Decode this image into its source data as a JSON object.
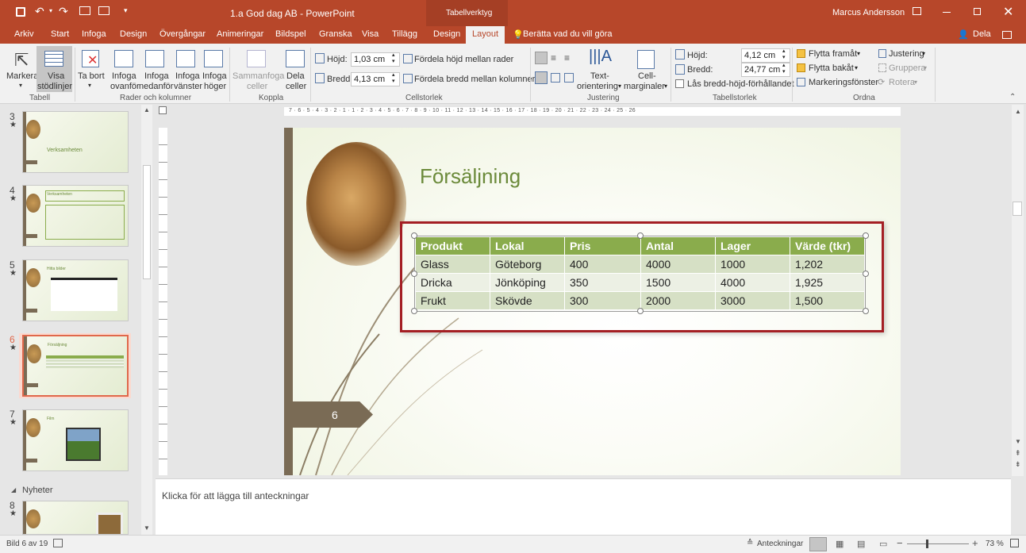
{
  "titlebar": {
    "title": "1.a God dag AB - PowerPoint",
    "context_tab": "Tabellverktyg",
    "user": "Marcus Andersson"
  },
  "tabs": [
    "Arkiv",
    "Start",
    "Infoga",
    "Design",
    "Övergångar",
    "Animeringar",
    "Bildspel",
    "Granska",
    "Visa",
    "Tillägg",
    "Design",
    "Layout"
  ],
  "tell_me": "Berätta vad du vill göra",
  "share": "Dela",
  "ribbon": {
    "markera": "Markera",
    "visa": "Visa",
    "stodlinjer": "stödlinjer",
    "ta_bort": "Ta bort",
    "infoga_ovanfor_1": "Infoga",
    "infoga_ovanfor_2": "ovanför",
    "infoga_nedanfor_1": "Infoga",
    "infoga_nedanfor_2": "nedanför",
    "infoga_vanster_1": "Infoga",
    "infoga_vanster_2": "vänster",
    "infoga_hoger_1": "Infoga",
    "infoga_hoger_2": "höger",
    "sammanfoga_1": "Sammanfoga",
    "sammanfoga_2": "celler",
    "dela_1": "Dela",
    "dela_2": "celler",
    "hojd_label": "Höjd:",
    "hojd_value": "1,03 cm",
    "bredd_label": "Bredd:",
    "bredd_value": "4,13 cm",
    "fordela_hojd": "Fördela höjd mellan rader",
    "fordela_bredd": "Fördela bredd mellan kolumner",
    "textorientering_1": "Text-",
    "textorientering_2": "orientering",
    "cellmarginaler_1": "Cell-",
    "cellmarginaler_2": "marginaler",
    "tab_hojd_label": "Höjd:",
    "tab_hojd_value": "4,12 cm",
    "tab_bredd_label": "Bredd:",
    "tab_bredd_value": "24,77 cm",
    "las": "Lås bredd-höjd-förhållandet",
    "flytta_fram": "Flytta framåt",
    "flytta_bak": "Flytta bakåt",
    "markeringsfonster": "Markeringsfönster",
    "justering_btn": "Justering",
    "gruppera": "Gruppera",
    "rotera": "Rotera",
    "groups": {
      "tabell": "Tabell",
      "rader": "Rader och kolumner",
      "koppla": "Koppla",
      "cellstorlek": "Cellstorlek",
      "justering": "Justering",
      "tabellstorlek": "Tabellstorlek",
      "ordna": "Ordna"
    }
  },
  "thumbnails": [
    {
      "num": "3",
      "caption": "Verksamheten"
    },
    {
      "num": "4",
      "caption": "Verksamheten"
    },
    {
      "num": "5",
      "caption": "Hitta bilder"
    },
    {
      "num": "6",
      "caption": "Försäljning"
    },
    {
      "num": "7",
      "caption": "Film"
    },
    {
      "num": "8",
      "caption": ""
    }
  ],
  "section_label": "Nyheter",
  "slide": {
    "title": "Försäljning",
    "slide_number": "6",
    "table": {
      "headers": [
        "Produkt",
        "Lokal",
        "Pris",
        "Antal",
        "Lager",
        "Värde (tkr)"
      ],
      "rows": [
        [
          "Glass",
          "Göteborg",
          "400",
          "4000",
          "1000",
          "1,202"
        ],
        [
          "Dricka",
          "Jönköping",
          "350",
          "1500",
          "4000",
          "1,925"
        ],
        [
          "Frukt",
          "Skövde",
          "300",
          "2000",
          "3000",
          "1,500"
        ]
      ]
    }
  },
  "ruler_h": "7 · 6 · 5 · 4 · 3 · 2 · 1 · 1 · 2 · 3 · 4 · 5 · 6 · 7 · 8 · 9 · 10 · 11 · 12 · 13 · 14 · 15 · 16 · 17 · 18 · 19 · 20 · 21 · 22 · 23 · 24 · 25 · 26",
  "notes_placeholder": "Klicka för att lägga till anteckningar",
  "status": {
    "slide": "Bild 6 av 19",
    "notes_btn": "Anteckningar",
    "zoom": "73 %"
  }
}
